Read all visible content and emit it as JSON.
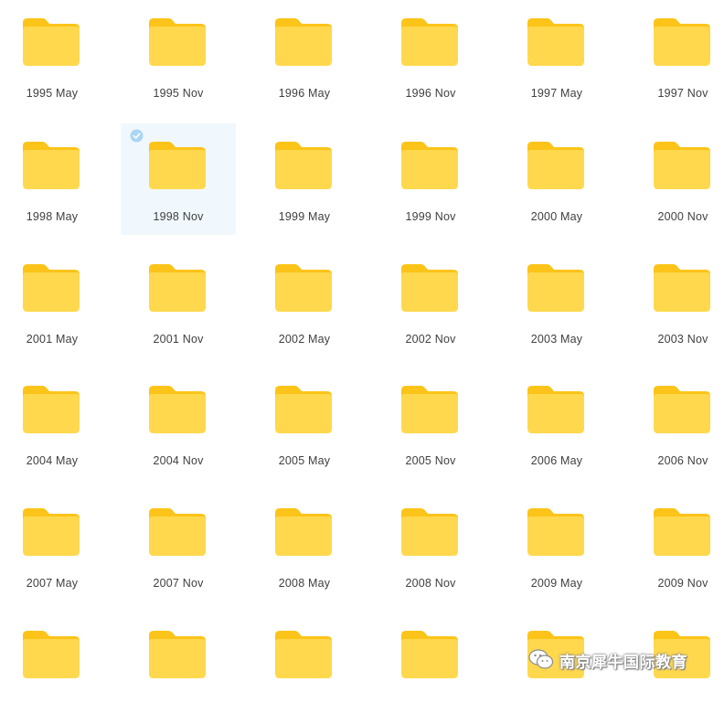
{
  "folders": [
    {
      "label": "1995 May",
      "selected": false
    },
    {
      "label": "1995 Nov",
      "selected": false
    },
    {
      "label": "1996 May",
      "selected": false
    },
    {
      "label": "1996 Nov",
      "selected": false
    },
    {
      "label": "1997 May",
      "selected": false
    },
    {
      "label": "1997 Nov",
      "selected": false
    },
    {
      "label": "1998 May",
      "selected": false
    },
    {
      "label": "1998 Nov",
      "selected": true
    },
    {
      "label": "1999 May",
      "selected": false
    },
    {
      "label": "1999 Nov",
      "selected": false
    },
    {
      "label": "2000 May",
      "selected": false
    },
    {
      "label": "2000 Nov",
      "selected": false
    },
    {
      "label": "2001 May",
      "selected": false
    },
    {
      "label": "2001 Nov",
      "selected": false
    },
    {
      "label": "2002 May",
      "selected": false
    },
    {
      "label": "2002 Nov",
      "selected": false
    },
    {
      "label": "2003 May",
      "selected": false
    },
    {
      "label": "2003 Nov",
      "selected": false
    },
    {
      "label": "2004 May",
      "selected": false
    },
    {
      "label": "2004 Nov",
      "selected": false
    },
    {
      "label": "2005 May",
      "selected": false
    },
    {
      "label": "2005 Nov",
      "selected": false
    },
    {
      "label": "2006 May",
      "selected": false
    },
    {
      "label": "2006 Nov",
      "selected": false
    },
    {
      "label": "2007 May",
      "selected": false
    },
    {
      "label": "2007 Nov",
      "selected": false
    },
    {
      "label": "2008 May",
      "selected": false
    },
    {
      "label": "2008 Nov",
      "selected": false
    },
    {
      "label": "2009 May",
      "selected": false
    },
    {
      "label": "2009 Nov",
      "selected": false
    },
    {
      "label": "",
      "selected": false
    },
    {
      "label": "",
      "selected": false
    },
    {
      "label": "",
      "selected": false
    },
    {
      "label": "",
      "selected": false
    },
    {
      "label": "",
      "selected": false
    },
    {
      "label": "",
      "selected": false
    }
  ],
  "icons": {
    "folder": "folder-icon",
    "check": "check-circle-icon",
    "watermark_logo": "wechat-icon"
  },
  "colors": {
    "folder_body": "#ffd84d",
    "folder_tab": "#fcc419",
    "selected_bg": "#f0f8fd",
    "check": "#a9d6f5",
    "label_text": "#404040"
  },
  "watermark": {
    "text": "南京犀牛国际教育"
  }
}
